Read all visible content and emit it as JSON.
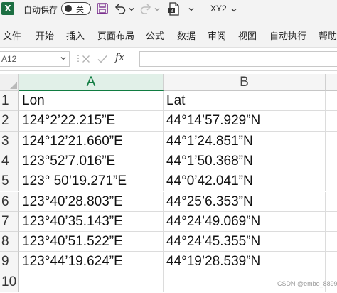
{
  "titlebar": {
    "app_icon_letter": "X",
    "autosave_label": "自动保存",
    "autosave_state": "关",
    "doc_title": "XY2"
  },
  "ribbon": {
    "tabs": [
      "文件",
      "开始",
      "插入",
      "页面布局",
      "公式",
      "数据",
      "审阅",
      "视图",
      "自动执行",
      "帮助"
    ]
  },
  "formula_bar": {
    "name_box": "A12",
    "fx_label": "fx",
    "formula": ""
  },
  "sheet": {
    "columns": [
      "A",
      "B"
    ],
    "selected_column": "A",
    "row_numbers": [
      "1",
      "2",
      "3",
      "4",
      "5",
      "6",
      "7",
      "8",
      "9",
      "10"
    ],
    "rows": [
      [
        "Lon",
        "Lat"
      ],
      [
        "124°2’22.215”E",
        "44°14’57.929”N"
      ],
      [
        "124°12’21.660”E",
        "44°1’24.851”N"
      ],
      [
        "123°52’7.016”E",
        "44°1’50.368”N"
      ],
      [
        "123° 50’19.271”E",
        "44°0’42.041”N"
      ],
      [
        "123°40’28.803”E",
        "44°25’6.353”N"
      ],
      [
        "123°40’35.143”E",
        "44°24’49.069”N"
      ],
      [
        "123°40’51.522”E",
        "44°24’45.355”N"
      ],
      [
        "123°44’19.624”E",
        "44°19’28.539”N"
      ],
      [
        "",
        ""
      ]
    ]
  },
  "watermark": "CSDN @embo_8899"
}
